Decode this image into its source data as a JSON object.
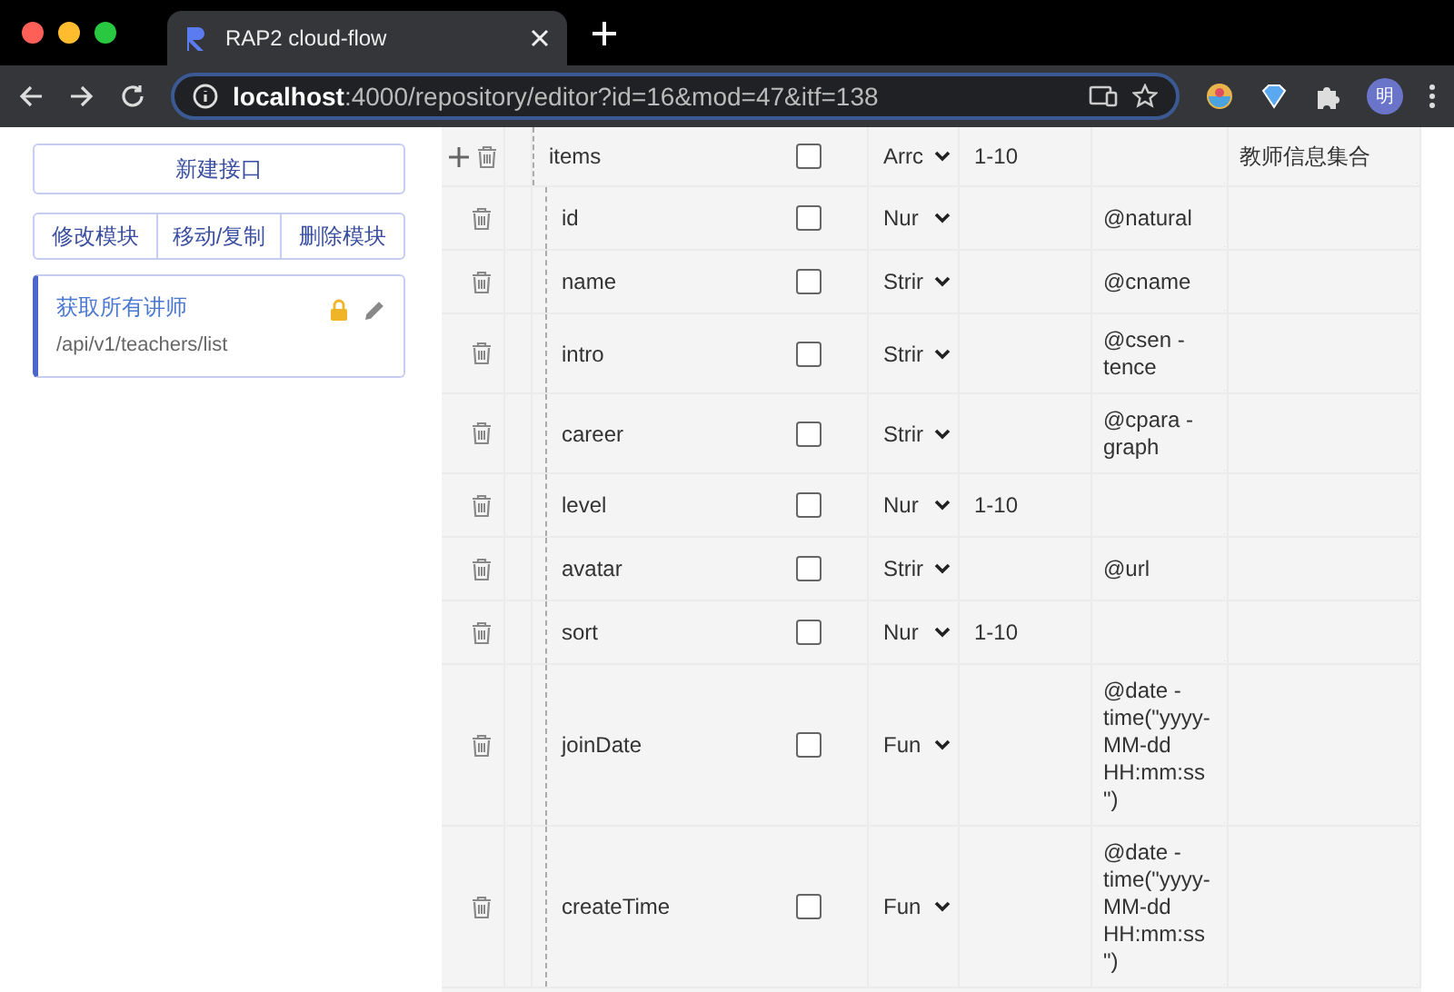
{
  "browser": {
    "tab_title": "RAP2 cloud-flow",
    "url_host": "localhost",
    "url_path": ":4000/repository/editor?id=16&mod=47&itf=138",
    "profile": "明"
  },
  "sidebar": {
    "new_button": "新建接口",
    "module_buttons": [
      "修改模块",
      "移动/复制",
      "删除模块"
    ],
    "interfaces": [
      {
        "name": "获取所有讲师",
        "path": "/api/v1/teachers/list",
        "locked": true,
        "selected": true
      }
    ]
  },
  "properties": [
    {
      "name": "items",
      "required": false,
      "type": "Arrc",
      "rule": "1-10",
      "description": "教师信息集合",
      "children": [
        {
          "name": "id",
          "required": false,
          "type": "Nur",
          "value": "@natural"
        },
        {
          "name": "name",
          "required": false,
          "type": "Strir",
          "value": "@cname"
        },
        {
          "name": "intro",
          "required": false,
          "type": "Strir",
          "value": "@csen -\ntence"
        },
        {
          "name": "career",
          "required": false,
          "type": "Strir",
          "value": "@cpara -\ngraph"
        },
        {
          "name": "level",
          "required": false,
          "type": "Nur",
          "rule": "1-10"
        },
        {
          "name": "avatar",
          "required": false,
          "type": "Strir",
          "value": "@url"
        },
        {
          "name": "sort",
          "required": false,
          "type": "Nur",
          "rule": "1-10"
        },
        {
          "name": "joinDate",
          "required": false,
          "type": "Fun",
          "value": "@date -\ntime(\"yyyy-\nMM-dd\nHH:mm:ss\n\")"
        },
        {
          "name": "createTime",
          "required": false,
          "type": "Fun",
          "value": "@date -\ntime(\"yyyy-\nMM-dd\nHH:mm:ss\n\")"
        }
      ]
    }
  ]
}
